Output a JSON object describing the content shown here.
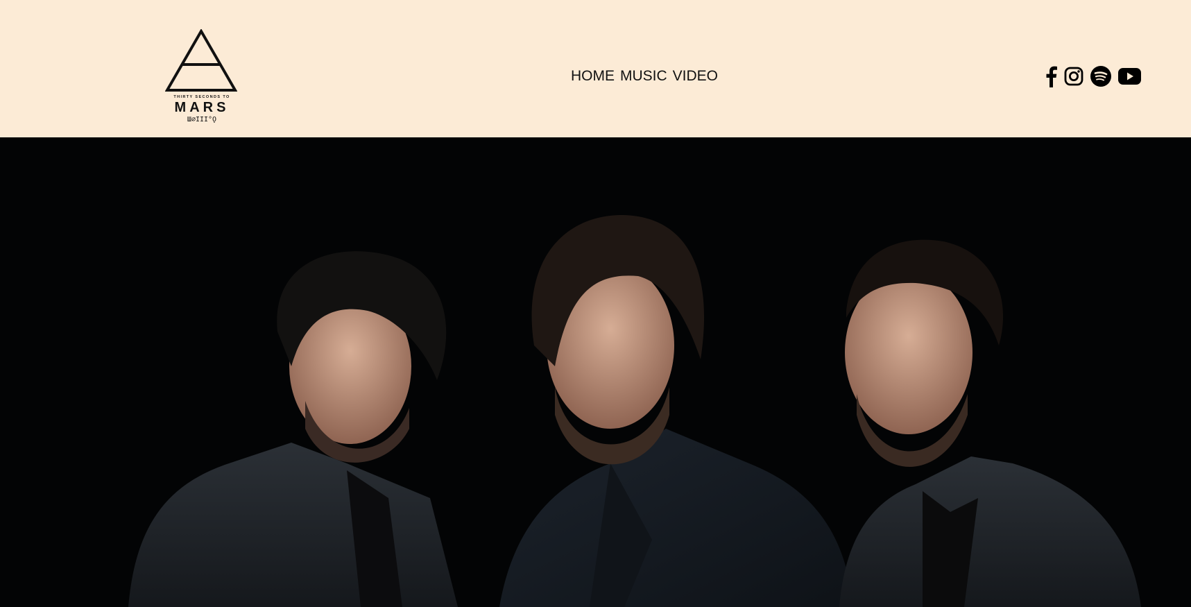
{
  "brand": {
    "tagline": "THIRTY SECONDS TO",
    "name": "MARS",
    "glyph_text": "Ш⌀ІІІ°Ǫ"
  },
  "nav": {
    "items": [
      "HOME",
      "MUSIC",
      "VIDEO"
    ]
  },
  "social": {
    "icons": [
      "facebook-icon",
      "instagram-icon",
      "spotify-icon",
      "youtube-icon"
    ]
  },
  "hero": {
    "image": "band-photo"
  },
  "colors": {
    "header_bg": "#fcebd6",
    "hero_bg": "#030405",
    "text": "#111111"
  }
}
